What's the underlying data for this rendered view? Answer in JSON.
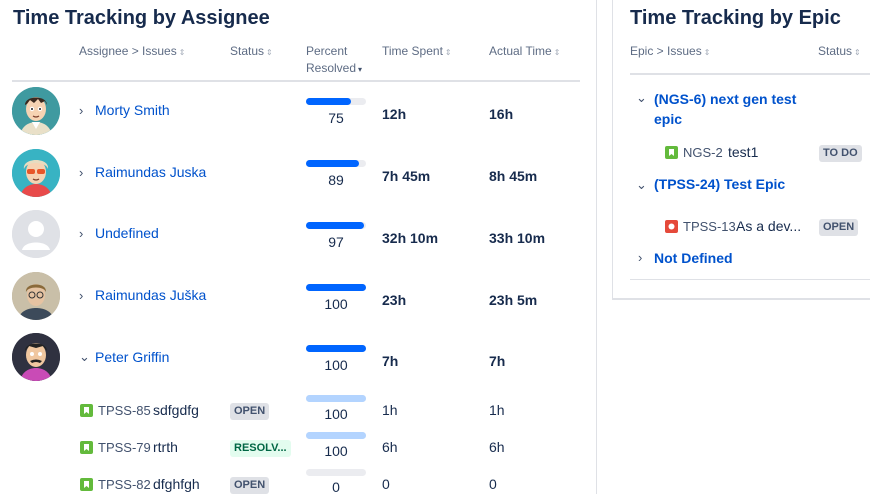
{
  "assignee_panel": {
    "title": "Time Tracking by Assignee",
    "columns": {
      "assignee": "Assignee > Issues",
      "status": "Status",
      "percent_line1": "Percent",
      "percent_line2": "Resolved",
      "time_spent": "Time Spent",
      "actual_time": "Actual Time"
    },
    "rows": [
      {
        "name": "Morty Smith",
        "percent": 75,
        "time_spent": "12h",
        "actual_time": "16h"
      },
      {
        "name": "Raimundas Juska",
        "percent": 89,
        "time_spent": "7h 45m",
        "actual_time": "8h 45m"
      },
      {
        "name": "Undefined",
        "percent": 97,
        "time_spent": "32h 10m",
        "actual_time": "33h 10m"
      },
      {
        "name": "Raimundas Juška",
        "percent": 100,
        "time_spent": "23h",
        "actual_time": "23h 5m"
      },
      {
        "name": "Peter Griffin",
        "percent": 100,
        "time_spent": "7h",
        "actual_time": "7h"
      }
    ],
    "issues": [
      {
        "key": "TPSS-85",
        "summary": "sdfgdfg",
        "status": "OPEN",
        "percent": 100,
        "time_spent": "1h",
        "actual_time": "1h"
      },
      {
        "key": "TPSS-79",
        "summary": "rtrth",
        "status": "RESOLV...",
        "percent": 100,
        "time_spent": "6h",
        "actual_time": "6h"
      },
      {
        "key": "TPSS-82",
        "summary": "dfghfgh",
        "status": "OPEN",
        "percent": 0,
        "time_spent": "0",
        "actual_time": "0"
      }
    ]
  },
  "epic_panel": {
    "title": "Time Tracking by Epic",
    "columns": {
      "epic": "Epic > Issues",
      "status": "Status"
    },
    "epics": [
      {
        "label_line1": "(NGS-6) next gen test",
        "label_line2": "epic"
      },
      {
        "label_line1": "(TPSS-24) Test Epic"
      },
      {
        "label_line1": "Not Defined"
      }
    ],
    "issues": [
      {
        "key": "NGS-2",
        "summary": "test1",
        "status": "TO DO",
        "type": "story"
      },
      {
        "key": "TPSS-13",
        "summary": "As a dev...",
        "status": "OPEN",
        "type": "bug"
      }
    ]
  },
  "colors": {
    "link": "#0052cc",
    "bar_fill": "#0065ff",
    "bar_fill_light": "#b3d4ff",
    "story": "#63ba3c",
    "bug": "#e5493a"
  }
}
